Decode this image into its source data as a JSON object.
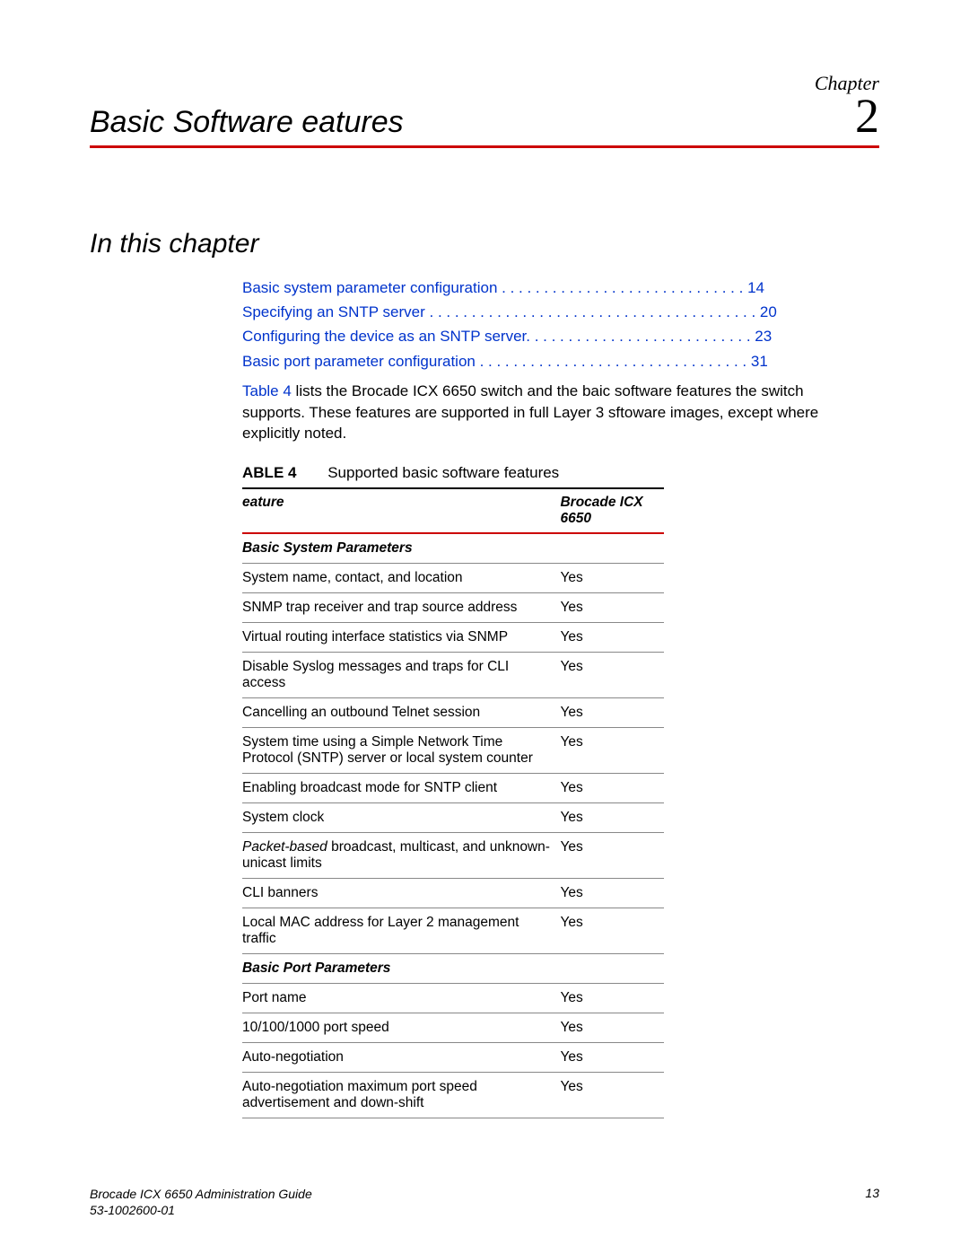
{
  "chapter": {
    "label": "Chapter",
    "number": "2",
    "title": "Basic Software  eatures"
  },
  "section_heading": "In this chapter",
  "toc": [
    {
      "text": "Basic system parameter configuration . . . . . . . . . . . . . . . . . . . . . . . . . . . . .   14"
    },
    {
      "text": "Specifying an SNTP server . . . . . . . . . . . . . . . . . . . . . . . . . . . . . . . . . . . . . . .  20"
    },
    {
      "text": "Configuring the device as an SNTP server. . . . . . . . . . . . . . . . . . . . . . . . . . .   23"
    },
    {
      "text": "Basic port parameter configuration . . . . . . . . . . . . . . . . . . . . . . . . . . . . . . . .   31"
    }
  ],
  "intro": {
    "link": "Table 4",
    "rest": " lists the Brocade ICX 6650 switch and the baic software features the switch supports. These features are supported in full Layer 3 sftoware images, except where explicitly noted."
  },
  "table": {
    "label": "ABLE 4",
    "caption": "Supported basic software features",
    "headers": {
      "feature": "eature",
      "value": "Brocade ICX 6650"
    },
    "sections": [
      {
        "title": "Basic System Parameters",
        "rows": [
          {
            "feature": "System name, contact, and location",
            "value": "Yes"
          },
          {
            "feature": "SNMP trap receiver and trap source address",
            "value": "Yes"
          },
          {
            "feature": "Virtual routing interface statistics via SNMP",
            "value": "Yes"
          },
          {
            "feature": "Disable Syslog messages and traps for CLI access",
            "value": "Yes"
          },
          {
            "feature": "Cancelling an outbound Telnet session",
            "value": "Yes"
          },
          {
            "feature": "System time using a Simple Network Time Protocol (SNTP) server or local system counter",
            "value": "Yes"
          },
          {
            "feature": "Enabling broadcast mode for SNTP client",
            "value": "Yes"
          },
          {
            "feature": "System clock",
            "value": "Yes"
          },
          {
            "feature_html": "<span class='em'>Packet-based</span> broadcast, multicast, and unknown-unicast limits",
            "value": "Yes"
          },
          {
            "feature": "CLI banners",
            "value": "Yes"
          },
          {
            "feature": "Local MAC address for Layer 2 management traffic",
            "value": "Yes"
          }
        ]
      },
      {
        "title": "Basic Port Parameters",
        "rows": [
          {
            "feature": "Port name",
            "value": "Yes"
          },
          {
            "feature": "10/100/1000 port speed",
            "value": "Yes"
          },
          {
            "feature": "Auto-negotiation",
            "value": "Yes"
          },
          {
            "feature": "Auto-negotiation maximum port speed advertisement and down-shift",
            "value": "Yes"
          }
        ]
      }
    ]
  },
  "footer": {
    "left1": "Brocade ICX 6650 Administration Guide",
    "left2": "53-1002600-01",
    "right": "13"
  }
}
